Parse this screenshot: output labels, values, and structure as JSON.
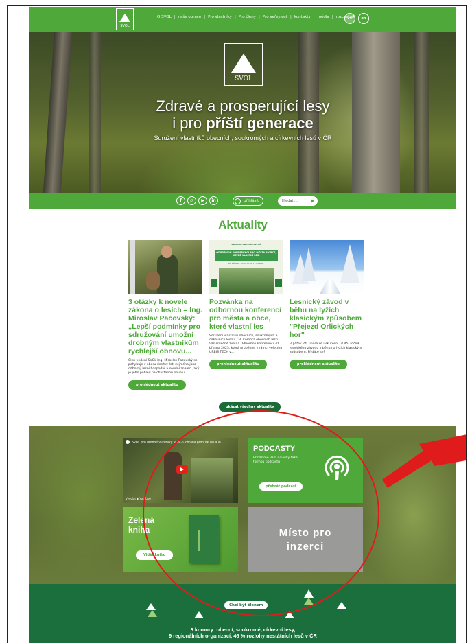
{
  "nav": {
    "logo_text": "SVOL",
    "items": [
      "O SVOL",
      "naše obrace",
      "Pro vlastníky",
      "Pro členy",
      "Pro veřejnost",
      "kontakty",
      "média",
      "rozcestník"
    ],
    "lang": [
      "cs",
      "en"
    ]
  },
  "hero": {
    "logo_text": "SVOL",
    "title_line1": "Zdravé a prosperující lesy",
    "title_line2_prefix": "i pro ",
    "title_line2_bold": "příští generace",
    "subtitle": "Sdružení vlastníků obecních, soukromých a církevních lesů v ČR"
  },
  "socialbar": {
    "icons": [
      "f",
      "◎",
      "▶",
      "in"
    ],
    "login_label": "přihlásit",
    "search_placeholder": "Hledat ..."
  },
  "news": {
    "title": "Aktuality",
    "cards": [
      {
        "title": "3 otázky k novele zákona o lesích – Ing. Miroslav Pacovský: „Lepší podmínky pro sdružování umožní drobným vlastníkům rychlejší obnovu...",
        "text": "Člen vedení SVOL Ing. Miroslav Pacovský se pohybuje v oboru desítky let, zejména jako odborný lesní hospodář a soudní znalec. Jaký je jeho pohled na chystanou novelu...",
        "button": "prohlédnout aktualitu"
      },
      {
        "title": "Pozvánka na odbornou konferenci pro města a obce, které vlastní les",
        "text": "Sdružení vlastníků obecních, soukromých a církevních lesů v ČR, Komora obecních lesů Vás srdečně zve na Odbornou konferenci 30. března 2023, která proběhne v rámci veletrhu URBIS TECH v...",
        "button": "prohlédnout aktualitu",
        "poster_lines": [
          "KOMORA OBECNÍCH LESŮ",
          "ODBORNOU KONFERENCI PRO MĚSTA A OBCE, KTERÉ VLASTNÍ LES,",
          "30. BŘEZNA 2023, 10:00–15:00 HOD."
        ]
      },
      {
        "title": "Lesnický závod v běhu na lyžích klasickým způsobem \"Přejezd Orlických hor\"",
        "text": "V pátek 24. února se uskuteční už 45. ročník lesnického závodu v běhu na lyžích klasickým způsobem. Přidáte se?",
        "button": "prohlédnout aktualitu"
      }
    ],
    "all_button": "ukázat všechny aktuality"
  },
  "promo": {
    "video_title": "SVOL pro drobné vlastníky lesa - Ochrana proti okusu a lo...",
    "video_watch": "Vyvolat ▶ YouTube",
    "podcast_title": "PODCASTY",
    "podcast_text": "Přinášíme Vám novinky také formou podcastů",
    "podcast_button": "přehrát podcast",
    "kniha_title": "Zelená kniha",
    "kniha_button": "Vidět knihu",
    "ad_text": "Místo pro inzerci"
  },
  "footer": {
    "member_button": "Chci být členem",
    "line1": "3 komory: obecní, soukromé, církevní lesy,",
    "line2": "9 regionálních organizací, 46 % rozlohy nestátních lesů v ČR"
  },
  "colors": {
    "brand_green": "#4ea83a",
    "dark_green": "#1b6f3c",
    "annotation_red": "#e01b1b"
  }
}
